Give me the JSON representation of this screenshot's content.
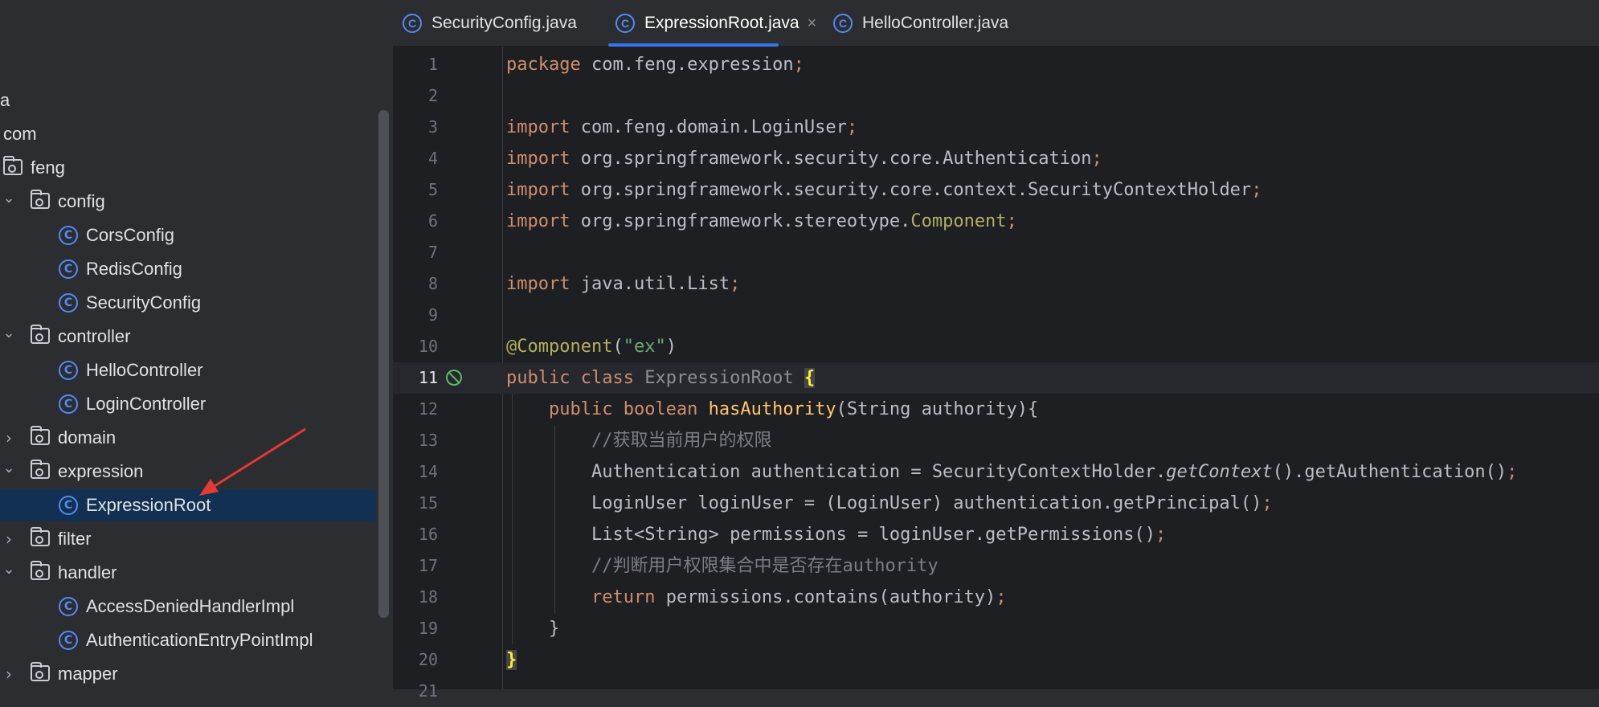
{
  "tabs": [
    {
      "label": "SecurityConfig.java",
      "active": false
    },
    {
      "label": "ExpressionRoot.java",
      "active": true,
      "close": "×"
    },
    {
      "label": "HelloController.java",
      "active": false
    }
  ],
  "icons": {
    "class_glyph": "C",
    "expand": "›",
    "collapse": "⌄"
  },
  "tree": [
    {
      "label": "a",
      "type": "text"
    },
    {
      "label": "com",
      "type": "text"
    },
    {
      "label": "feng",
      "type": "folder"
    },
    {
      "label": "config",
      "type": "folder",
      "state": "expanded"
    },
    {
      "label": "CorsConfig",
      "type": "class"
    },
    {
      "label": "RedisConfig",
      "type": "class"
    },
    {
      "label": "SecurityConfig",
      "type": "class"
    },
    {
      "label": "controller",
      "type": "folder",
      "state": "expanded"
    },
    {
      "label": "HelloController",
      "type": "class"
    },
    {
      "label": "LoginController",
      "type": "class"
    },
    {
      "label": "domain",
      "type": "folder",
      "state": "collapsed"
    },
    {
      "label": "expression",
      "type": "folder",
      "state": "expanded"
    },
    {
      "label": "ExpressionRoot",
      "type": "class",
      "selected": true
    },
    {
      "label": "filter",
      "type": "folder",
      "state": "collapsed"
    },
    {
      "label": "handler",
      "type": "folder",
      "state": "expanded"
    },
    {
      "label": "AccessDeniedHandlerImpl",
      "type": "class"
    },
    {
      "label": "AuthenticationEntryPointImpl",
      "type": "class"
    },
    {
      "label": "mapper",
      "type": "folder",
      "state": "collapsed"
    }
  ],
  "editor": {
    "current_line": 11,
    "lines": [
      {
        "no": "1",
        "tokens": [
          [
            "kw",
            "package"
          ],
          [
            "",
            "com.feng.expression"
          ],
          [
            "kw",
            ";"
          ]
        ]
      },
      {
        "no": "2",
        "tokens": []
      },
      {
        "no": "3",
        "tokens": [
          [
            "kw",
            "import"
          ],
          [
            "",
            "com.feng.domain.LoginUser"
          ],
          [
            "kw",
            ";"
          ]
        ]
      },
      {
        "no": "4",
        "tokens": [
          [
            "kw",
            "import"
          ],
          [
            "",
            "org.springframework.security.core.Authentication"
          ],
          [
            "kw",
            ";"
          ]
        ]
      },
      {
        "no": "5",
        "tokens": [
          [
            "kw",
            "import"
          ],
          [
            "",
            "org.springframework.security.core.context.SecurityContextHolder"
          ],
          [
            "kw",
            ";"
          ]
        ]
      },
      {
        "no": "6",
        "tokens": [
          [
            "kw",
            "import"
          ],
          [
            "",
            "org.springframework.stereotype."
          ],
          [
            "ann",
            "Component"
          ],
          [
            "kw",
            ";"
          ]
        ]
      },
      {
        "no": "7",
        "tokens": []
      },
      {
        "no": "8",
        "tokens": [
          [
            "kw",
            "import"
          ],
          [
            "",
            "java.util.List"
          ],
          [
            "kw",
            ";"
          ]
        ]
      },
      {
        "no": "9",
        "tokens": []
      },
      {
        "no": "10",
        "tokens": [
          [
            "ann",
            "@Component"
          ],
          [
            "",
            "("
          ],
          [
            "str",
            "\"ex\""
          ],
          [
            "",
            ")"
          ]
        ]
      },
      {
        "no": "11",
        "tokens": [
          [
            "kw",
            "public class"
          ],
          [
            "gray",
            "ExpressionRoot"
          ],
          [
            "brace-match",
            "{"
          ]
        ]
      },
      {
        "no": "12",
        "indent": 1,
        "tokens": [
          [
            "kw",
            "public boolean"
          ],
          [
            "mth",
            "hasAuthority"
          ],
          [
            "",
            "(String authority){"
          ]
        ]
      },
      {
        "no": "13",
        "indent": 2,
        "tokens": [
          [
            "cmt",
            "//获取当前用户的权限"
          ]
        ]
      },
      {
        "no": "14",
        "indent": 2,
        "tokens": [
          [
            "",
            "Authentication authentication = SecurityContextHolder."
          ],
          [
            "it",
            "getContext"
          ],
          [
            "",
            "().getAuthentication()"
          ],
          [
            "kw",
            ";"
          ]
        ]
      },
      {
        "no": "15",
        "indent": 2,
        "tokens": [
          [
            "",
            "LoginUser loginUser = (LoginUser) authentication.getPrincipal()"
          ],
          [
            "kw",
            ";"
          ]
        ]
      },
      {
        "no": "16",
        "indent": 2,
        "tokens": [
          [
            "",
            "List<String> permissions = loginUser.getPermissions()"
          ],
          [
            "kw",
            ";"
          ]
        ]
      },
      {
        "no": "17",
        "indent": 2,
        "tokens": [
          [
            "cmt",
            "//判断用户权限集合中是否存在authority"
          ]
        ]
      },
      {
        "no": "18",
        "indent": 2,
        "tokens": [
          [
            "kw",
            "return"
          ],
          [
            "",
            "permissions.contains(authority)"
          ],
          [
            "kw",
            ";"
          ]
        ]
      },
      {
        "no": "19",
        "indent": 1,
        "tokens": [
          [
            "",
            "}"
          ]
        ]
      },
      {
        "no": "20",
        "tokens": [
          [
            "brace-match",
            "}"
          ]
        ]
      },
      {
        "no": "21",
        "tokens": []
      }
    ]
  },
  "colors": {
    "sidebar_bg": "#2b2d30",
    "editor_bg": "#1e1f22",
    "selection": "#123152",
    "keyword": "#cf8e6d",
    "string": "#6aab73",
    "annotation": "#b3ae60",
    "method": "#ffc66d",
    "comment": "#7a7e85",
    "class_icon": "#548af7",
    "arrow": "#e53935"
  }
}
